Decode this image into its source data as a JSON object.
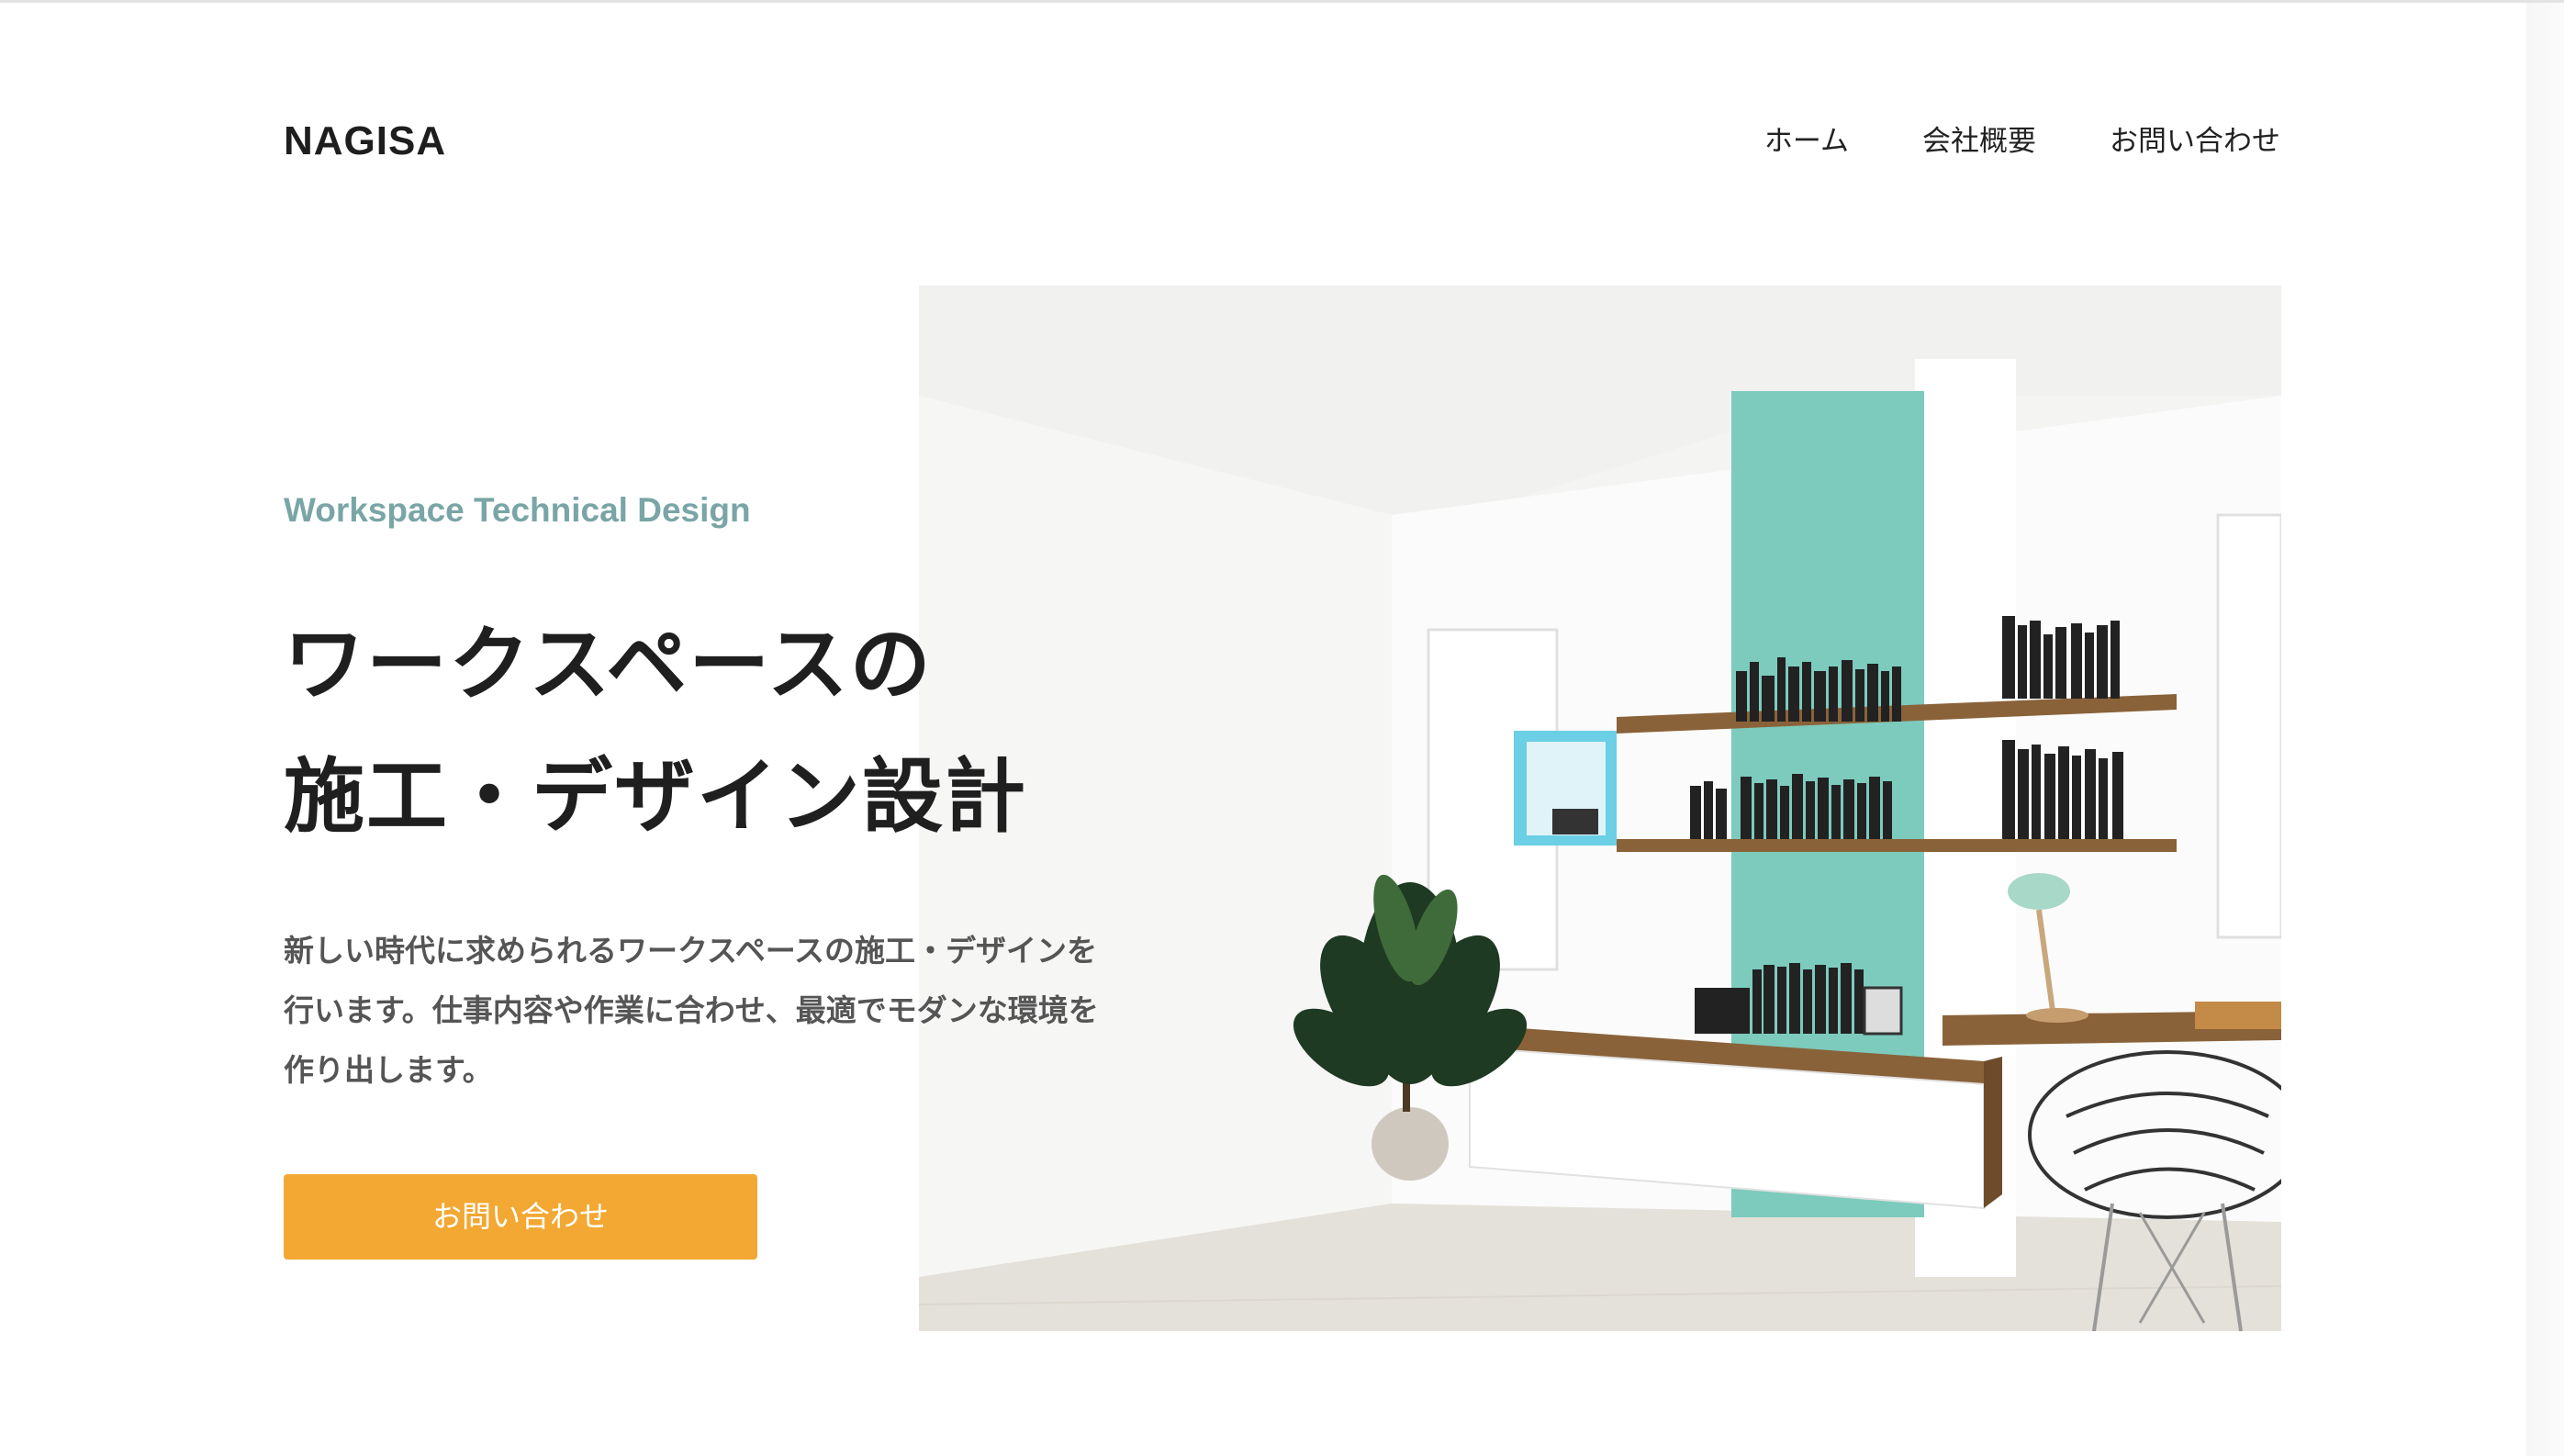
{
  "header": {
    "logo": "NAGISA",
    "nav": [
      {
        "label": "ホーム"
      },
      {
        "label": "会社概要"
      },
      {
        "label": "お問い合わせ"
      }
    ]
  },
  "hero": {
    "eyebrow": "Workspace Technical Design",
    "headline_lines": [
      "ワークスペースの",
      "施工・デザイン設計"
    ],
    "lead_lines": [
      "新しい時代に求められるワークスペースの施工・デザインを",
      "行います。仕事内容や作業に合わせ、最適でモダンな環境を",
      "作り出します。"
    ],
    "cta_label": "お問い合わせ"
  },
  "colors": {
    "accent_button": "#f2a832",
    "eyebrow": "#7aa5a6",
    "wall_accent": "#7ccbbd"
  }
}
